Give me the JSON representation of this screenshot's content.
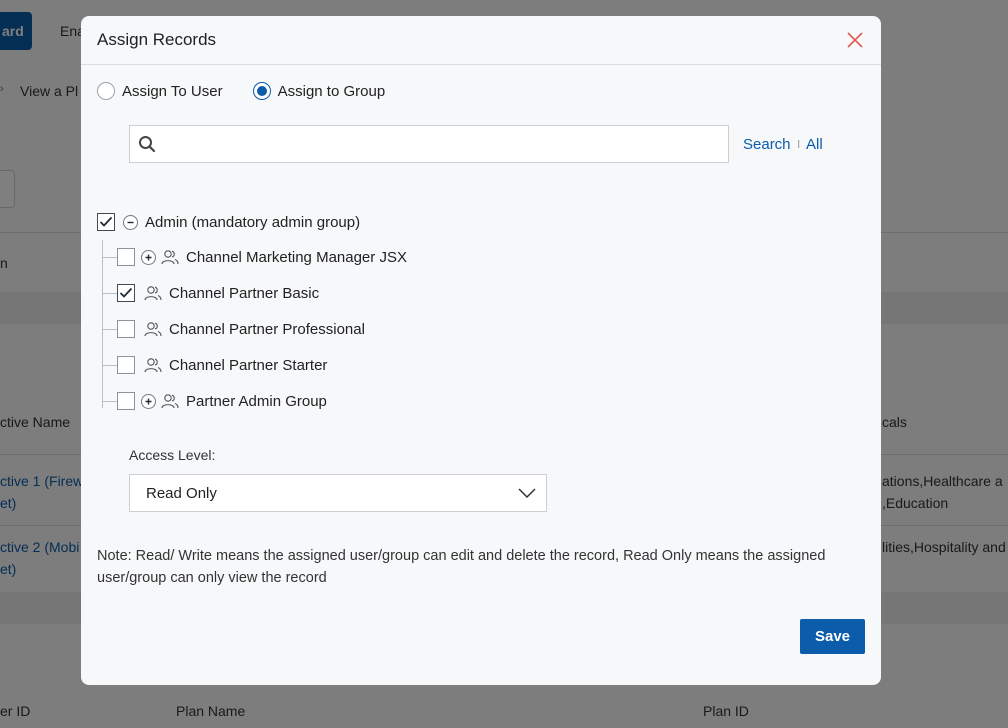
{
  "background": {
    "button_label": "ard",
    "tab_label": "Ena",
    "breadcrumb_sep": "›",
    "breadcrumb_text": "View a Pl",
    "col_header_1": "ctive Name",
    "col_header_2": "cals",
    "row1_line1": "ctive 1 (Firew",
    "row1_line2": "et)",
    "row2_line1": "ctive 2 (Mobi",
    "row2_line2": "et)",
    "row1_right_1": "ations,Healthcare a",
    "row1_right_2": ",Education",
    "row2_right_1": "lities,Hospitality and",
    "row_h_label": "n",
    "footer_col_1": "er ID",
    "footer_col_2": "Plan Name",
    "footer_col_3": "Plan ID"
  },
  "modal": {
    "title": "Assign Records",
    "assign_options": [
      {
        "label": "Assign To User",
        "selected": false
      },
      {
        "label": "Assign to Group",
        "selected": true
      }
    ],
    "search": {
      "value": "",
      "placeholder": "",
      "search_link": "Search",
      "separator": "l",
      "all_link": "All"
    },
    "tree": {
      "root": {
        "label": "Admin (mandatory admin group)",
        "checked": true,
        "expanded": true
      },
      "children": [
        {
          "label": "Channel Marketing Manager JSX",
          "checked": false,
          "has_children": true
        },
        {
          "label": "Channel Partner Basic",
          "checked": true,
          "has_children": false
        },
        {
          "label": "Channel Partner Professional",
          "checked": false,
          "has_children": false
        },
        {
          "label": "Channel Partner Starter",
          "checked": false,
          "has_children": false
        },
        {
          "label": "Partner Admin Group",
          "checked": false,
          "has_children": true
        }
      ]
    },
    "access_level": {
      "label": "Access Level:",
      "selected": "Read Only"
    },
    "note": "Note: Read/ Write means the assigned user/group can edit and delete the record, Read Only means the assigned user/group can only view the record",
    "save_label": "Save"
  },
  "colors": {
    "accent": "#0b5cab",
    "close_icon": "#e05a4f",
    "overlay": "rgba(0,0,0,0.5)"
  }
}
